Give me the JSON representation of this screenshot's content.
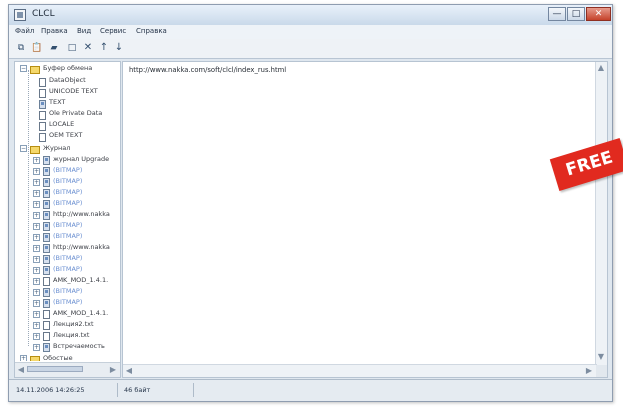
{
  "window": {
    "title": "CLCL",
    "controls": {
      "minimize": "—",
      "maximize": "□",
      "close": "✕"
    },
    "menu": [
      "Файл",
      "Правка",
      "Вид",
      "Сервис",
      "Справка"
    ],
    "toolbar_icons": [
      "copy-icon",
      "paste-icon",
      "folder-icon",
      "new-document-icon",
      "delete-icon",
      "move-up-icon",
      "move-down-icon"
    ],
    "tree": {
      "clipboard_label": "Буфер обмена",
      "clipboard_items": [
        "DataObject",
        "UNICODE TEXT",
        "TEXT",
        "Ole Private Data",
        "LOCALE",
        "OEM TEXT"
      ],
      "journal_label": "Журнал",
      "journal_items": [
        "журнал Upgrade",
        "(BITMAP)",
        "(BITMAP)",
        "(BITMAP)",
        "(BITMAP)",
        "http://www.nakka",
        "(BITMAP)",
        "(BITMAP)",
        "http://www.nakka",
        "(BITMAP)",
        "(BITMAP)",
        "AMK_MOD_1.4.1.",
        "(BITMAP)",
        "(BITMAP)",
        "AMK_MOD_1.4.1.",
        "Лекция2.txt",
        "Лекция.txt",
        "Встречаемость"
      ],
      "templates_label": "Обостые"
    },
    "content_text": "http://www.nakka.com/soft/clcl/index_rus.html",
    "status_bar": {
      "timestamp": "14.11.2006 14:26:25",
      "size": "46 байт"
    },
    "badge": "FREE"
  }
}
